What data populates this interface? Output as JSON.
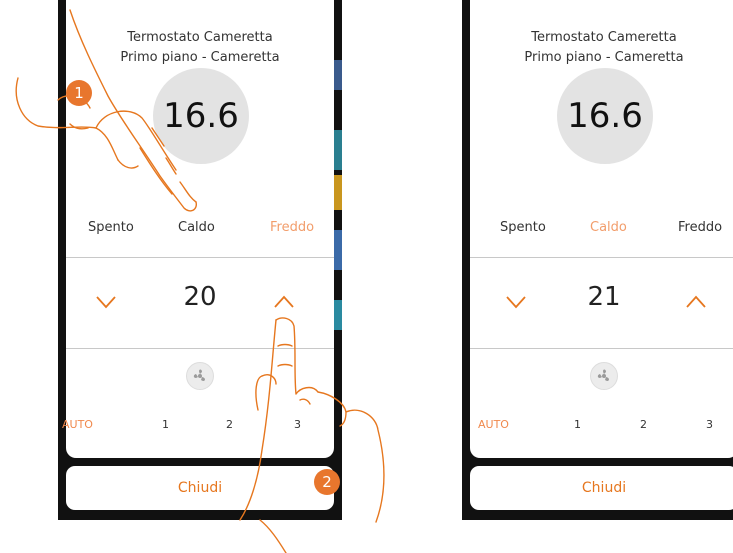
{
  "left_screen": {
    "title": "Termostato Cameretta",
    "subtitle": "Primo piano - Cameretta",
    "temperature": "16.6",
    "modes": [
      "Spento",
      "Caldo",
      "Freddo"
    ],
    "active_mode": "Freddo",
    "setpoint": "20",
    "fan_speeds": [
      "AUTO",
      "1",
      "2",
      "3"
    ],
    "close_label": "Chiudi",
    "step_badges": [
      "1",
      "2"
    ]
  },
  "right_screen": {
    "title": "Termostato Cameretta",
    "subtitle": "Primo piano - Cameretta",
    "temperature": "16.6",
    "modes": [
      "Spento",
      "Caldo",
      "Freddo"
    ],
    "active_mode": "Caldo",
    "setpoint": "21",
    "fan_speeds": [
      "AUTO",
      "1",
      "2",
      "3"
    ],
    "close_label": "Chiudi"
  },
  "colors": {
    "accent": "#e6771f",
    "active_mode": "#f29d6b",
    "badge": "#e8762d"
  }
}
